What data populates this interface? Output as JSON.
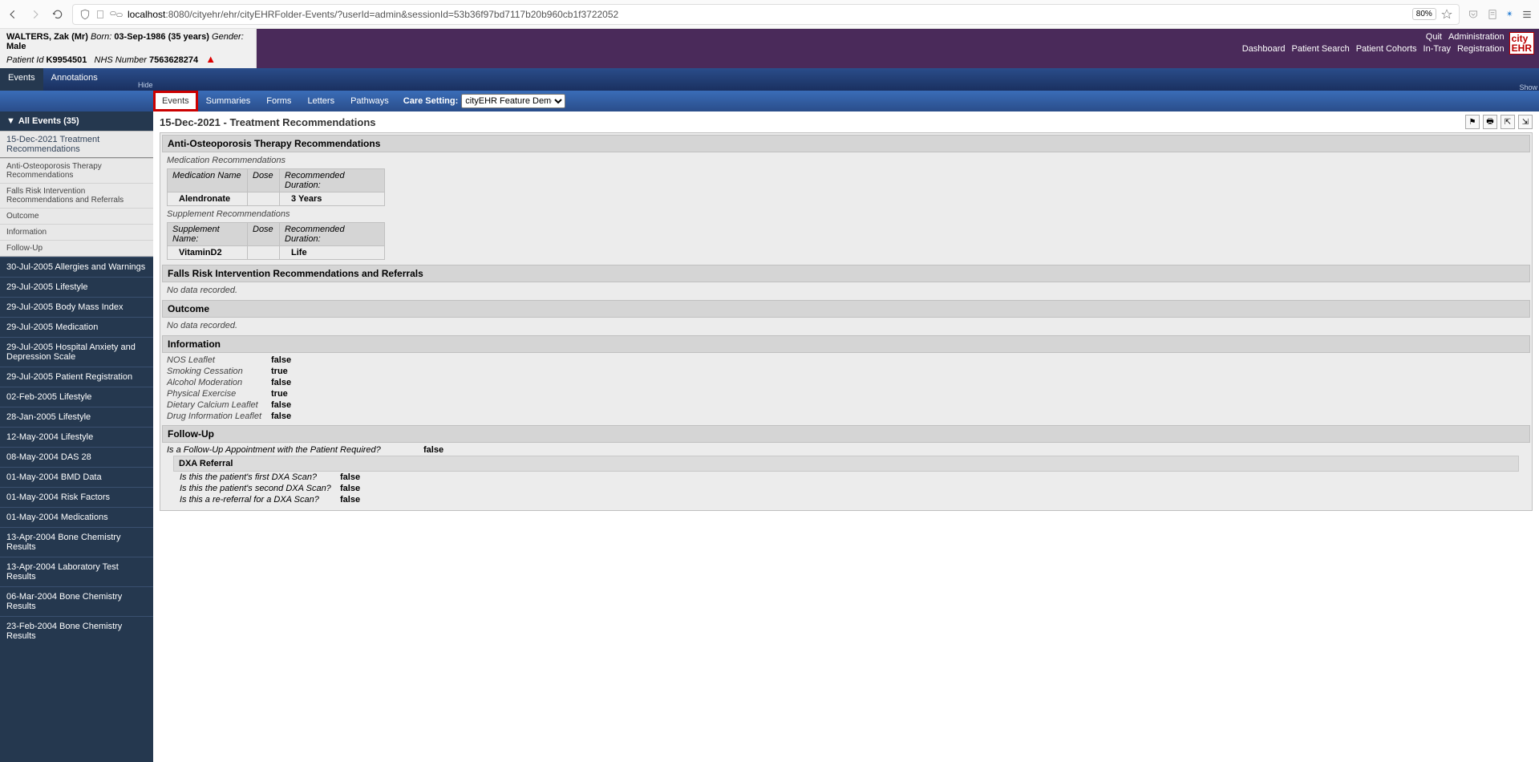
{
  "browser": {
    "url_prefix": "localhost",
    "url_rest": ":8080/cityehr/ehr/cityEHRFolder-Events/?userId=admin&sessionId=53b36f97bd7117b20b960cb1f3722052",
    "zoom": "80%"
  },
  "patient": {
    "surname": "WALTERS,",
    "first": "Zak",
    "title_suffix": "(Mr)",
    "born_label": "Born:",
    "dob": "03-Sep-1986",
    "age": "(35 years)",
    "gender_label": "Gender:",
    "gender": "Male",
    "pid_label": "Patient Id",
    "pid": "K9954501",
    "nhs_label": "NHS Number",
    "nhs": "7563628274"
  },
  "top_links_row1": [
    "Quit",
    "Administration"
  ],
  "top_links_row2": [
    "Dashboard",
    "Patient Search",
    "Patient Cohorts",
    "In-Tray",
    "Registration"
  ],
  "logo": {
    "l1": "city",
    "l2": "EHR"
  },
  "main_tabs": [
    "Events",
    "Annotations"
  ],
  "hide_label": "Hide",
  "show_label": "Show",
  "sub_tabs": [
    "Events",
    "Summaries",
    "Forms",
    "Letters",
    "Pathways"
  ],
  "care_setting_label": "Care Setting:",
  "care_setting_value": "cityEHR Feature Demo",
  "sidebar_header": "All Events (35)",
  "selected_event": "15-Dec-2021 Treatment Recommendations",
  "sub_sections": [
    "Anti-Osteoporosis Therapy Recommendations",
    "Falls Risk Intervention Recommendations and Referrals",
    "Outcome",
    "Information",
    "Follow-Up"
  ],
  "other_events": [
    "30-Jul-2005 Allergies and Warnings",
    "29-Jul-2005 Lifestyle",
    "29-Jul-2005 Body Mass Index",
    "29-Jul-2005 Medication",
    "29-Jul-2005 Hospital Anxiety and Depression Scale",
    "29-Jul-2005 Patient Registration",
    "02-Feb-2005 Lifestyle",
    "28-Jan-2005 Lifestyle",
    "12-May-2004 Lifestyle",
    "08-May-2004 DAS 28",
    "01-May-2004 BMD Data",
    "01-May-2004 Risk Factors",
    "01-May-2004 Medications",
    "13-Apr-2004 Bone Chemistry Results",
    "13-Apr-2004 Laboratory Test Results",
    "06-Mar-2004 Bone Chemistry Results",
    "23-Feb-2004 Bone Chemistry Results"
  ],
  "content_title": "15-Dec-2021 - Treatment Recommendations",
  "sec1": {
    "title": "Anti-Osteoporosis Therapy Recommendations",
    "med_rec_label": "Medication Recommendations",
    "med_headers": [
      "Medication Name",
      "Dose",
      "Recommended Duration:"
    ],
    "med_row": [
      "Alendronate",
      "",
      "3 Years"
    ],
    "sup_rec_label": "Supplement Recommendations",
    "sup_headers": [
      "Supplement Name:",
      "Dose",
      "Recommended Duration:"
    ],
    "sup_row": [
      "VitaminD2",
      "",
      "Life"
    ]
  },
  "sec2": {
    "title": "Falls Risk Intervention Recommendations and Referrals",
    "nodata": "No data recorded."
  },
  "sec3": {
    "title": "Outcome",
    "nodata": "No data recorded."
  },
  "sec4": {
    "title": "Information",
    "rows": [
      {
        "label": "NOS Leaflet",
        "val": "false"
      },
      {
        "label": "Smoking Cessation",
        "val": "true"
      },
      {
        "label": "Alcohol Moderation",
        "val": "false"
      },
      {
        "label": "Physical Exercise",
        "val": "true"
      },
      {
        "label": "Dietary Calcium Leaflet",
        "val": "false"
      },
      {
        "label": "Drug Information Leaflet",
        "val": "false"
      }
    ]
  },
  "sec5": {
    "title": "Follow-Up",
    "q1": {
      "label": "Is a Follow-Up Appointment with the Patient Required?",
      "val": "false"
    },
    "dxa_title": "DXA Referral",
    "dxa_rows": [
      {
        "label": "Is this the patient's first DXA Scan?",
        "val": "false"
      },
      {
        "label": "Is this the patient's second DXA Scan?",
        "val": "false"
      },
      {
        "label": "Is this a re-referral for a DXA Scan?",
        "val": "false"
      }
    ]
  }
}
